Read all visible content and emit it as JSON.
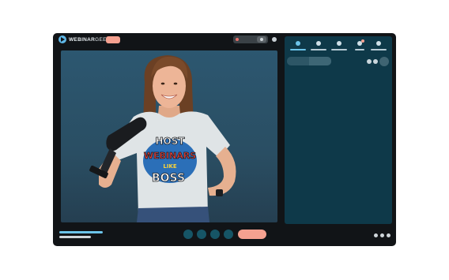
{
  "app": {
    "logo": {
      "brand_bold": "WEBINAR",
      "brand_thin": "GEEK"
    }
  },
  "stage": {
    "shirt_text": [
      "HOST",
      "WEBINARS",
      "LIKE",
      "BOSS"
    ]
  },
  "sidebar": {
    "tabs": [
      {
        "icon": "chat-icon",
        "active": true
      },
      {
        "icon": "questions-icon",
        "active": false
      },
      {
        "icon": "polls-icon",
        "active": false
      },
      {
        "icon": "attendees-icon",
        "active": false,
        "badge": true
      },
      {
        "icon": "more-icon",
        "active": false
      }
    ]
  },
  "colors": {
    "accent_coral": "#f5a190",
    "accent_blue": "#6cc4ea",
    "frame_dark": "#111417",
    "panel_teal": "#0e3949",
    "stage_bg": "#2c5770"
  }
}
